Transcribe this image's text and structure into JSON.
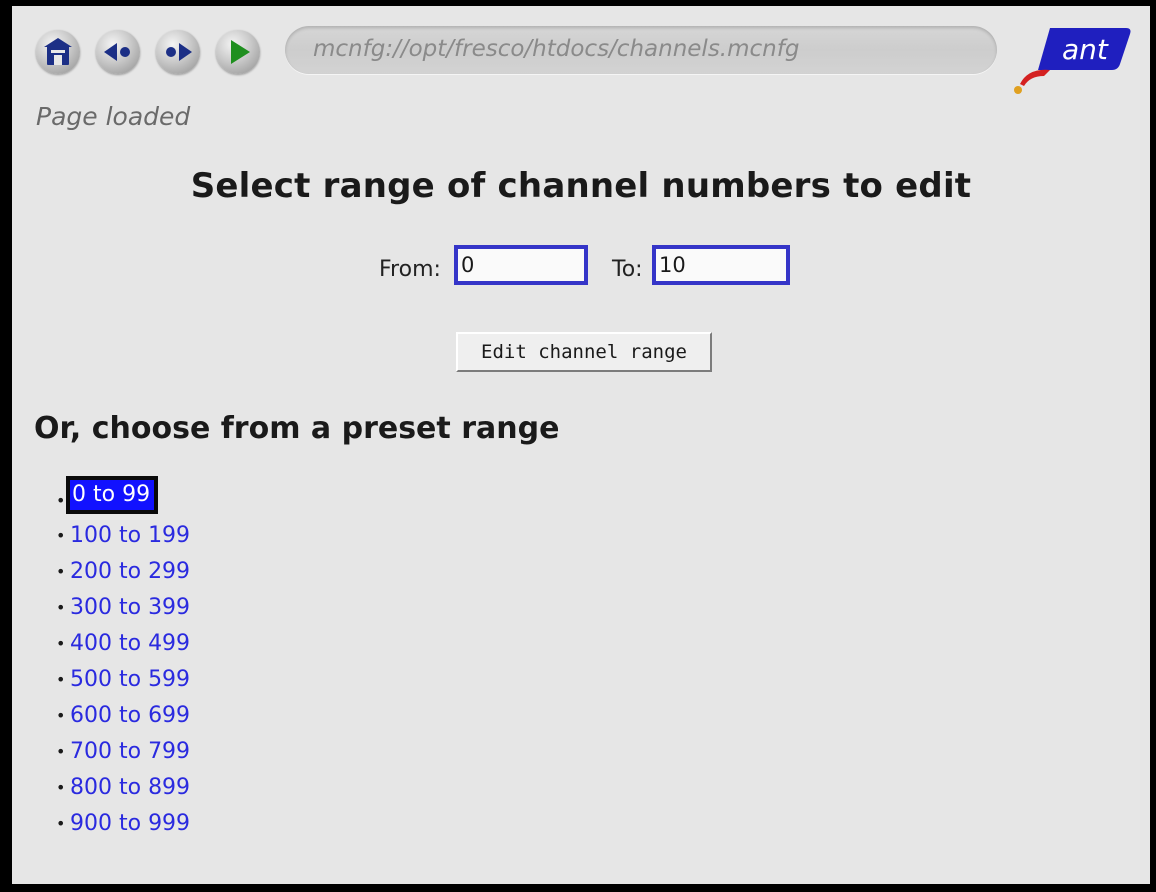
{
  "browser": {
    "address": "mcnfg://opt/fresco/htdocs/channels.mcnfg",
    "status": "Page loaded",
    "logo_text": "ant",
    "nav_icons": [
      "home-icon",
      "back-icon",
      "forward-icon",
      "go-icon"
    ]
  },
  "page": {
    "heading": "Select range of channel numbers to edit",
    "from_label": "From:",
    "from_value": "0",
    "to_label": "To:",
    "to_value": "10",
    "edit_button_label": "Edit channel range",
    "preset_heading": "Or, choose from a preset range",
    "presets": [
      {
        "label": "0 to 99",
        "focused": true
      },
      {
        "label": "100 to 199"
      },
      {
        "label": "200 to 299"
      },
      {
        "label": "300 to 399"
      },
      {
        "label": "400 to 499"
      },
      {
        "label": "500 to 599"
      },
      {
        "label": "600 to 699"
      },
      {
        "label": "700 to 799"
      },
      {
        "label": "800 to 899"
      },
      {
        "label": "900 to 999"
      }
    ]
  },
  "colors": {
    "background": "#e6e6e6",
    "link": "#2a2adf",
    "focus_fill": "#1212ff",
    "input_border": "#3535c8",
    "logo_blue": "#1f1fbf",
    "logo_red": "#d42020",
    "go_green": "#1f8f1f"
  }
}
